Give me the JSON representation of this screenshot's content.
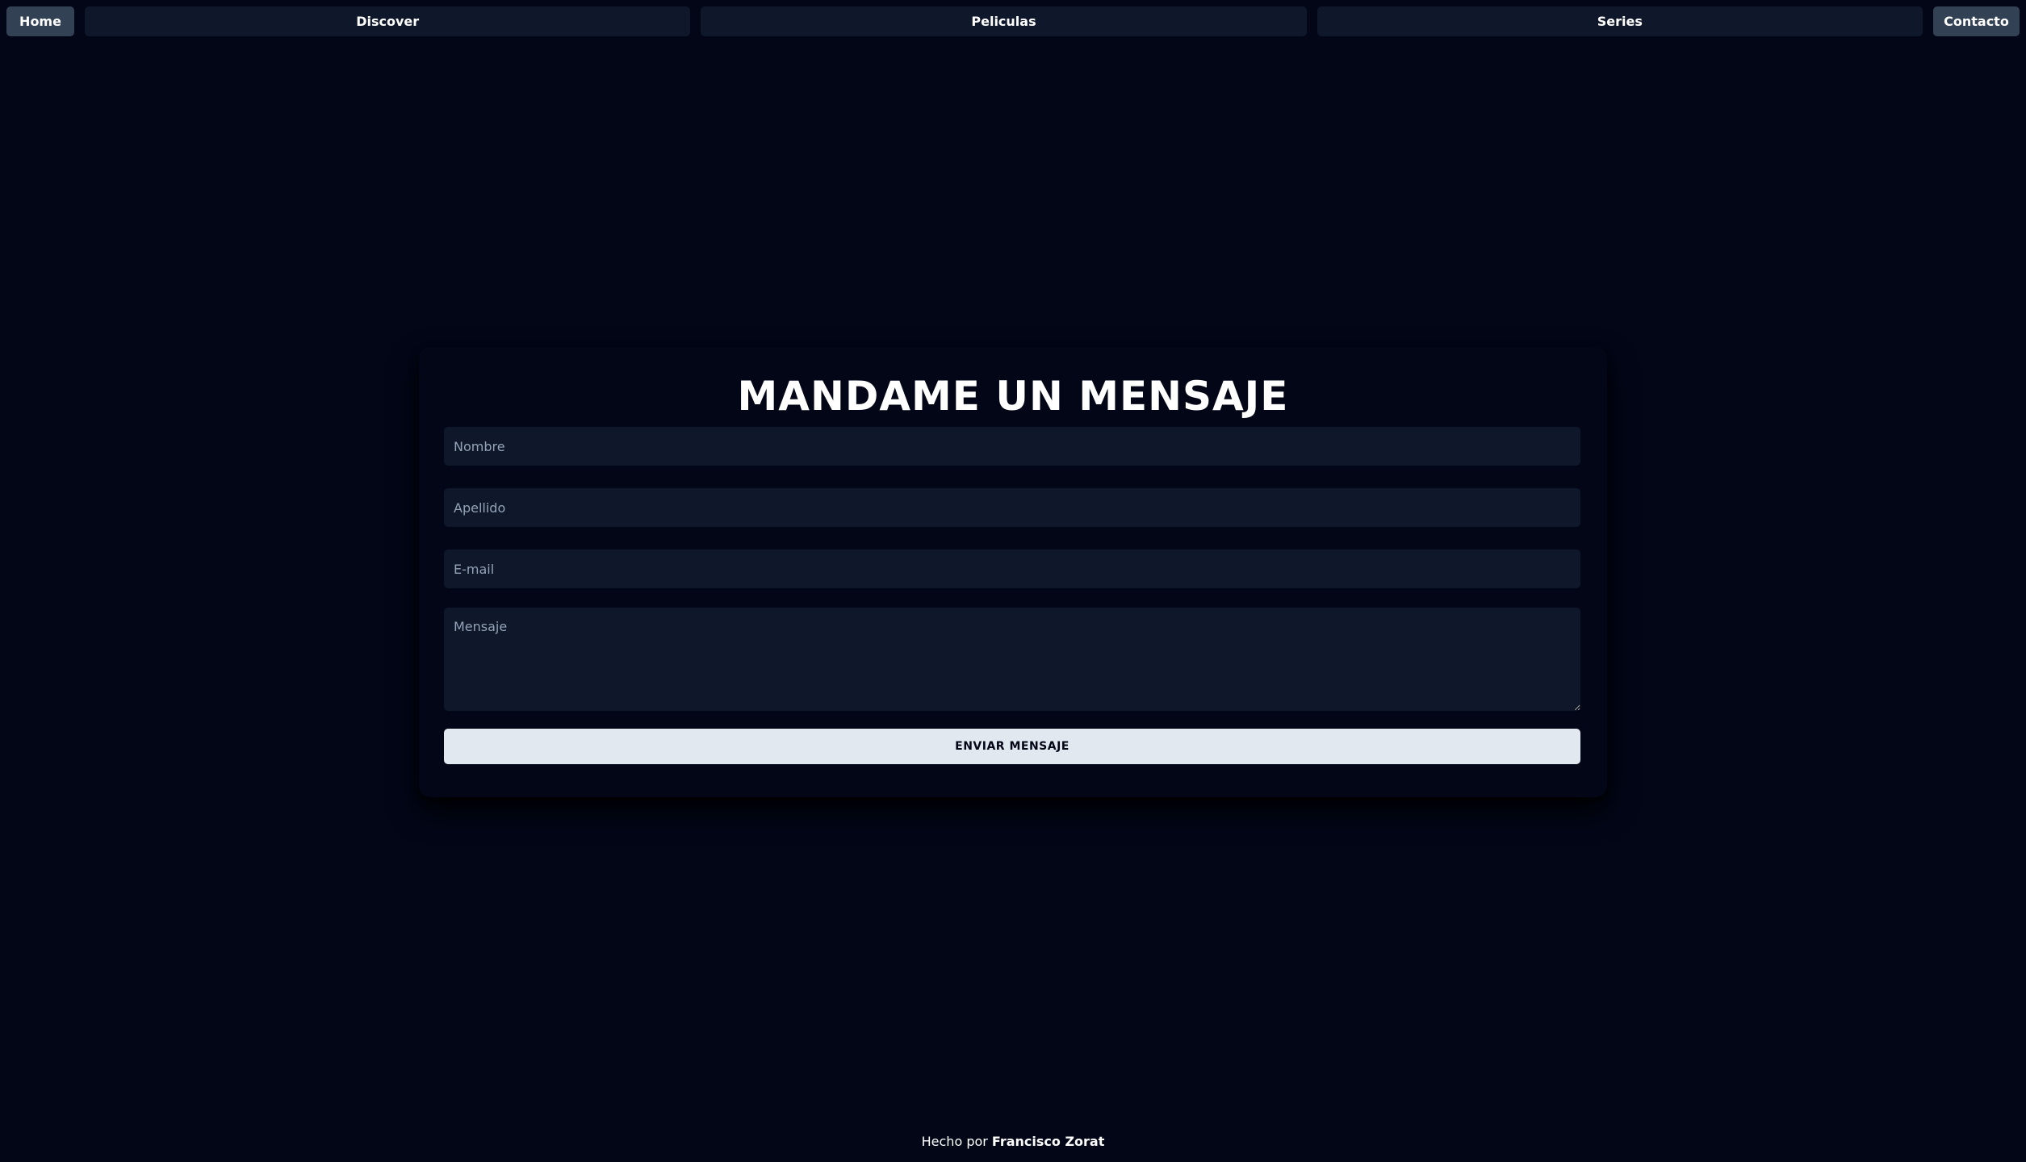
{
  "nav": {
    "home": "Home",
    "discover": "Discover",
    "peliculas": "Peliculas",
    "series": "Series",
    "contacto": "Contacto"
  },
  "form": {
    "title": "MANDAME UN MENSAJE",
    "nombre_placeholder": "Nombre",
    "apellido_placeholder": "Apellido",
    "email_placeholder": "E-mail",
    "mensaje_placeholder": "Mensaje",
    "submit_label": "ENVIAR MENSAJE"
  },
  "footer": {
    "prefix": "Hecho por",
    "author": "Francisco Zorat"
  },
  "colors": {
    "background": "#020617",
    "surface": "#0f172a",
    "accent": "#334155",
    "button": "#e2e8f0"
  }
}
